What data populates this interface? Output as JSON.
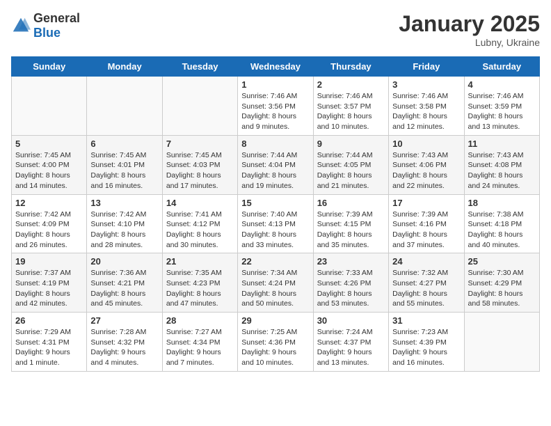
{
  "header": {
    "logo_general": "General",
    "logo_blue": "Blue",
    "month_year": "January 2025",
    "location": "Lubny, Ukraine"
  },
  "weekdays": [
    "Sunday",
    "Monday",
    "Tuesday",
    "Wednesday",
    "Thursday",
    "Friday",
    "Saturday"
  ],
  "weeks": [
    [
      {
        "day": "",
        "info": ""
      },
      {
        "day": "",
        "info": ""
      },
      {
        "day": "",
        "info": ""
      },
      {
        "day": "1",
        "info": "Sunrise: 7:46 AM\nSunset: 3:56 PM\nDaylight: 8 hours and 9 minutes."
      },
      {
        "day": "2",
        "info": "Sunrise: 7:46 AM\nSunset: 3:57 PM\nDaylight: 8 hours and 10 minutes."
      },
      {
        "day": "3",
        "info": "Sunrise: 7:46 AM\nSunset: 3:58 PM\nDaylight: 8 hours and 12 minutes."
      },
      {
        "day": "4",
        "info": "Sunrise: 7:46 AM\nSunset: 3:59 PM\nDaylight: 8 hours and 13 minutes."
      }
    ],
    [
      {
        "day": "5",
        "info": "Sunrise: 7:45 AM\nSunset: 4:00 PM\nDaylight: 8 hours and 14 minutes."
      },
      {
        "day": "6",
        "info": "Sunrise: 7:45 AM\nSunset: 4:01 PM\nDaylight: 8 hours and 16 minutes."
      },
      {
        "day": "7",
        "info": "Sunrise: 7:45 AM\nSunset: 4:03 PM\nDaylight: 8 hours and 17 minutes."
      },
      {
        "day": "8",
        "info": "Sunrise: 7:44 AM\nSunset: 4:04 PM\nDaylight: 8 hours and 19 minutes."
      },
      {
        "day": "9",
        "info": "Sunrise: 7:44 AM\nSunset: 4:05 PM\nDaylight: 8 hours and 21 minutes."
      },
      {
        "day": "10",
        "info": "Sunrise: 7:43 AM\nSunset: 4:06 PM\nDaylight: 8 hours and 22 minutes."
      },
      {
        "day": "11",
        "info": "Sunrise: 7:43 AM\nSunset: 4:08 PM\nDaylight: 8 hours and 24 minutes."
      }
    ],
    [
      {
        "day": "12",
        "info": "Sunrise: 7:42 AM\nSunset: 4:09 PM\nDaylight: 8 hours and 26 minutes."
      },
      {
        "day": "13",
        "info": "Sunrise: 7:42 AM\nSunset: 4:10 PM\nDaylight: 8 hours and 28 minutes."
      },
      {
        "day": "14",
        "info": "Sunrise: 7:41 AM\nSunset: 4:12 PM\nDaylight: 8 hours and 30 minutes."
      },
      {
        "day": "15",
        "info": "Sunrise: 7:40 AM\nSunset: 4:13 PM\nDaylight: 8 hours and 33 minutes."
      },
      {
        "day": "16",
        "info": "Sunrise: 7:39 AM\nSunset: 4:15 PM\nDaylight: 8 hours and 35 minutes."
      },
      {
        "day": "17",
        "info": "Sunrise: 7:39 AM\nSunset: 4:16 PM\nDaylight: 8 hours and 37 minutes."
      },
      {
        "day": "18",
        "info": "Sunrise: 7:38 AM\nSunset: 4:18 PM\nDaylight: 8 hours and 40 minutes."
      }
    ],
    [
      {
        "day": "19",
        "info": "Sunrise: 7:37 AM\nSunset: 4:19 PM\nDaylight: 8 hours and 42 minutes."
      },
      {
        "day": "20",
        "info": "Sunrise: 7:36 AM\nSunset: 4:21 PM\nDaylight: 8 hours and 45 minutes."
      },
      {
        "day": "21",
        "info": "Sunrise: 7:35 AM\nSunset: 4:23 PM\nDaylight: 8 hours and 47 minutes."
      },
      {
        "day": "22",
        "info": "Sunrise: 7:34 AM\nSunset: 4:24 PM\nDaylight: 8 hours and 50 minutes."
      },
      {
        "day": "23",
        "info": "Sunrise: 7:33 AM\nSunset: 4:26 PM\nDaylight: 8 hours and 53 minutes."
      },
      {
        "day": "24",
        "info": "Sunrise: 7:32 AM\nSunset: 4:27 PM\nDaylight: 8 hours and 55 minutes."
      },
      {
        "day": "25",
        "info": "Sunrise: 7:30 AM\nSunset: 4:29 PM\nDaylight: 8 hours and 58 minutes."
      }
    ],
    [
      {
        "day": "26",
        "info": "Sunrise: 7:29 AM\nSunset: 4:31 PM\nDaylight: 9 hours and 1 minute."
      },
      {
        "day": "27",
        "info": "Sunrise: 7:28 AM\nSunset: 4:32 PM\nDaylight: 9 hours and 4 minutes."
      },
      {
        "day": "28",
        "info": "Sunrise: 7:27 AM\nSunset: 4:34 PM\nDaylight: 9 hours and 7 minutes."
      },
      {
        "day": "29",
        "info": "Sunrise: 7:25 AM\nSunset: 4:36 PM\nDaylight: 9 hours and 10 minutes."
      },
      {
        "day": "30",
        "info": "Sunrise: 7:24 AM\nSunset: 4:37 PM\nDaylight: 9 hours and 13 minutes."
      },
      {
        "day": "31",
        "info": "Sunrise: 7:23 AM\nSunset: 4:39 PM\nDaylight: 9 hours and 16 minutes."
      },
      {
        "day": "",
        "info": ""
      }
    ]
  ]
}
